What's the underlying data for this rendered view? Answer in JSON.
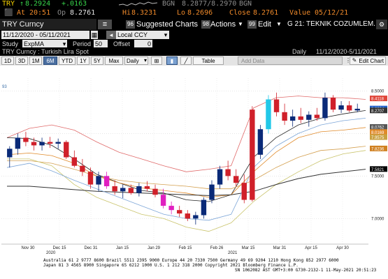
{
  "quote": {
    "ticker": "TRY",
    "last": "8.2924",
    "change": "+.0163",
    "source1": "BGN",
    "bid_ask": "8.2877/8.2970",
    "source2": "BGN",
    "at_label": "At",
    "time": "20:51",
    "op_label": "Op",
    "open": "8.2761",
    "hi_label": "Hi",
    "high": "8.3231",
    "lo_label": "Lo",
    "low": "8.2696",
    "close_label": "Close",
    "close": "8.2761",
    "value_label": "Value",
    "value_date": "05/12/21"
  },
  "toolbar": {
    "title": "TRY Curncy",
    "suggested_num": "96",
    "suggested_label": "Suggested Charts",
    "actions_num": "98",
    "actions_label": "Actions",
    "edit_num": "99",
    "edit_label": "Edit",
    "g_label": "G 21: TEKNIK COZUMLEM..."
  },
  "range": {
    "dates": "11/12/2020 - 05/11/2021",
    "currency": "Local CCY"
  },
  "study": {
    "study_label": "Study",
    "study_value": "ExpMA",
    "period_label": "Period",
    "period_value": "50",
    "offset_label": "Offset",
    "offset_value": "0"
  },
  "info": {
    "description": "TRY Curncy : Turkish Lira Spot",
    "frequency": "Daily",
    "span": "11/12/2020-5/11/2021"
  },
  "periods": [
    "1D",
    "3D",
    "1M",
    "6M",
    "YTD",
    "1Y",
    "5Y",
    "Max"
  ],
  "selected_period": "6M",
  "freq_select": "Daily",
  "table_label": "Table",
  "add_data_label": "Add Data",
  "edit_chart_label": "Edit Chart",
  "chart_data": {
    "type": "line",
    "title": "",
    "x_labels": [
      "Nov 30",
      "Dec 15",
      "Dec 31",
      "Jan 15",
      "Jan 29",
      "Feb 15",
      "Feb 26",
      "Mar 15",
      "Mar 31",
      "Apr 15",
      "Apr 30"
    ],
    "year_labels": [
      "2020",
      "2021"
    ],
    "y_ticks": [
      "8.5000",
      "8.0000",
      "7.5000",
      "7.0000"
    ],
    "ylim": [
      6.7,
      8.65
    ],
    "top_fragment": "93",
    "price_tags": [
      {
        "value": "8.4118",
        "color": "#e0463a"
      },
      {
        "value": "8.2924",
        "color": "#1f5fc8"
      },
      {
        "value": "8.2707",
        "color": "#333333"
      },
      {
        "value": "8.0762",
        "color": "#555555"
      },
      {
        "value": "8.0169",
        "color": "#e08a2a"
      },
      {
        "value": "7.9575",
        "color": "#c9a040"
      },
      {
        "value": "7.8236",
        "color": "#d08020"
      },
      {
        "value": "7.5821",
        "color": "#000000"
      }
    ],
    "series": [
      {
        "name": "",
        "color": "#e06a6a",
        "values": [
          7.95,
          8.06,
          8.1,
          8.04,
          7.9,
          7.78,
          7.7,
          7.62,
          7.55,
          7.58,
          7.62,
          8.3,
          8.42,
          8.44,
          8.42,
          8.42,
          8.4
        ]
      },
      {
        "name": "",
        "color": "#222222",
        "values": [
          7.95,
          7.94,
          7.86,
          7.7,
          7.52,
          7.42,
          7.33,
          7.3,
          7.22,
          7.2,
          7.28,
          7.72,
          7.95,
          8.1,
          8.18,
          8.23,
          8.27
        ]
      },
      {
        "name": "",
        "color": "#e08a2a",
        "values": [
          7.75,
          7.77,
          7.74,
          7.65,
          7.5,
          7.42,
          7.36,
          7.33,
          7.3,
          7.25,
          7.28,
          7.55,
          7.78,
          7.95,
          8.02,
          8.04,
          8.07
        ]
      },
      {
        "name": "",
        "color": "#d4a050",
        "values": [
          7.68,
          7.68,
          7.65,
          7.58,
          7.5,
          7.45,
          7.42,
          7.4,
          7.38,
          7.35,
          7.35,
          7.45,
          7.6,
          7.72,
          7.8,
          7.82,
          7.85
        ]
      },
      {
        "name": "",
        "color": "#c9c36a",
        "values": [
          7.7,
          7.7,
          7.62,
          7.4,
          7.25,
          7.15,
          7.05,
          7.0,
          6.9,
          6.85,
          6.95,
          7.2,
          7.4,
          7.55,
          7.68,
          7.76,
          7.8
        ]
      },
      {
        "name": "",
        "color": "#333333",
        "values": [
          7.38,
          7.38,
          7.36,
          7.34,
          7.32,
          7.31,
          7.3,
          7.29,
          7.28,
          7.27,
          7.28,
          7.32,
          7.4,
          7.47,
          7.52,
          7.55,
          7.58
        ]
      },
      {
        "name": "",
        "color": "#7da6d8",
        "values": [
          7.6,
          7.65,
          7.56,
          7.45,
          7.35,
          7.25,
          7.15,
          7.05,
          7.0,
          6.98,
          7.05,
          7.6,
          7.85,
          8.0,
          8.1,
          8.15,
          8.18
        ]
      }
    ],
    "candles": [
      {
        "o": 7.72,
        "h": 7.85,
        "l": 7.6,
        "c": 7.82,
        "col": "#0a2a78"
      },
      {
        "o": 7.82,
        "h": 8.0,
        "l": 7.75,
        "c": 7.95,
        "col": "#0a2a78"
      },
      {
        "o": 7.95,
        "h": 8.02,
        "l": 7.85,
        "c": 7.9,
        "col": "#d0202a"
      },
      {
        "o": 7.9,
        "h": 7.95,
        "l": 7.8,
        "c": 7.86,
        "col": "#d0202a"
      },
      {
        "o": 7.86,
        "h": 7.95,
        "l": 7.8,
        "c": 7.9,
        "col": "#0a2a78"
      },
      {
        "o": 7.9,
        "h": 7.96,
        "l": 7.83,
        "c": 7.88,
        "col": "#d0202a"
      },
      {
        "o": 7.88,
        "h": 7.94,
        "l": 7.82,
        "c": 7.9,
        "col": "#0a2a78"
      },
      {
        "o": 7.9,
        "h": 7.92,
        "l": 7.7,
        "c": 7.72,
        "col": "#d0202a"
      },
      {
        "o": 7.72,
        "h": 7.8,
        "l": 7.6,
        "c": 7.62,
        "col": "#d0202a"
      },
      {
        "o": 7.62,
        "h": 7.7,
        "l": 7.5,
        "c": 7.55,
        "col": "#d0202a"
      },
      {
        "o": 7.55,
        "h": 7.6,
        "l": 7.35,
        "c": 7.4,
        "col": "#d0202a"
      },
      {
        "o": 7.4,
        "h": 7.55,
        "l": 7.32,
        "c": 7.5,
        "col": "#0a2a78"
      },
      {
        "o": 7.5,
        "h": 7.55,
        "l": 7.35,
        "c": 7.38,
        "col": "#e020c0"
      },
      {
        "o": 7.38,
        "h": 7.45,
        "l": 7.28,
        "c": 7.32,
        "col": "#d0202a"
      },
      {
        "o": 7.32,
        "h": 7.4,
        "l": 7.24,
        "c": 7.36,
        "col": "#0a2a78"
      },
      {
        "o": 7.36,
        "h": 7.4,
        "l": 7.28,
        "c": 7.3,
        "col": "#d0202a"
      },
      {
        "o": 7.3,
        "h": 7.42,
        "l": 7.26,
        "c": 7.38,
        "col": "#0a2a78"
      },
      {
        "o": 7.38,
        "h": 7.44,
        "l": 7.32,
        "c": 7.35,
        "col": "#d0202a"
      },
      {
        "o": 7.35,
        "h": 7.4,
        "l": 7.25,
        "c": 7.28,
        "col": "#d0202a"
      },
      {
        "o": 7.28,
        "h": 7.35,
        "l": 7.12,
        "c": 7.15,
        "col": "#e020c0"
      },
      {
        "o": 7.15,
        "h": 7.2,
        "l": 7.05,
        "c": 7.1,
        "col": "#e020c0"
      },
      {
        "o": 7.1,
        "h": 7.15,
        "l": 7.02,
        "c": 7.06,
        "col": "#d0202a"
      },
      {
        "o": 7.06,
        "h": 7.1,
        "l": 6.97,
        "c": 7.0,
        "col": "#d0202a"
      },
      {
        "o": 7.0,
        "h": 7.08,
        "l": 6.93,
        "c": 7.04,
        "col": "#0a2a78"
      },
      {
        "o": 7.04,
        "h": 7.25,
        "l": 7.0,
        "c": 7.22,
        "col": "#0a2a78"
      },
      {
        "o": 7.22,
        "h": 7.45,
        "l": 7.18,
        "c": 7.4,
        "col": "#0a2a78"
      },
      {
        "o": 7.4,
        "h": 7.62,
        "l": 7.35,
        "c": 7.58,
        "col": "#0a2a78"
      },
      {
        "o": 7.58,
        "h": 7.68,
        "l": 7.45,
        "c": 7.5,
        "col": "#d0202a"
      },
      {
        "o": 7.5,
        "h": 7.58,
        "l": 7.38,
        "c": 7.42,
        "col": "#d0202a"
      },
      {
        "o": 7.42,
        "h": 7.52,
        "l": 7.18,
        "c": 7.22,
        "col": "#d0202a"
      },
      {
        "o": 7.22,
        "h": 8.32,
        "l": 7.2,
        "c": 8.28,
        "col": "#d0202a"
      },
      {
        "o": 7.75,
        "h": 8.1,
        "l": 7.7,
        "c": 8.05,
        "col": "#0a2a78"
      },
      {
        "o": 8.05,
        "h": 8.45,
        "l": 8.0,
        "c": 8.4,
        "col": "#22c8e8"
      },
      {
        "o": 8.4,
        "h": 8.48,
        "l": 8.2,
        "c": 8.25,
        "col": "#d0202a"
      },
      {
        "o": 8.25,
        "h": 8.35,
        "l": 8.1,
        "c": 8.15,
        "col": "#d0202a"
      },
      {
        "o": 8.15,
        "h": 8.28,
        "l": 8.08,
        "c": 8.2,
        "col": "#0a2a78"
      },
      {
        "o": 8.2,
        "h": 8.3,
        "l": 8.12,
        "c": 8.16,
        "col": "#d0202a"
      },
      {
        "o": 8.16,
        "h": 8.26,
        "l": 8.08,
        "c": 8.22,
        "col": "#0a2a78"
      },
      {
        "o": 8.22,
        "h": 8.3,
        "l": 8.15,
        "c": 8.18,
        "col": "#d0202a"
      },
      {
        "o": 8.18,
        "h": 8.48,
        "l": 8.15,
        "c": 8.42,
        "col": "#0a2a78"
      },
      {
        "o": 8.42,
        "h": 8.45,
        "l": 8.25,
        "c": 8.28,
        "col": "#d0202a"
      },
      {
        "o": 8.28,
        "h": 8.38,
        "l": 8.24,
        "c": 8.33,
        "col": "#0a2a78"
      },
      {
        "o": 8.33,
        "h": 8.38,
        "l": 8.25,
        "c": 8.27,
        "col": "#d0202a"
      },
      {
        "o": 8.27,
        "h": 8.35,
        "l": 8.25,
        "c": 8.29,
        "col": "#0a2a78"
      }
    ]
  },
  "footer": {
    "line1": "Australia 61 2 9777 8600 Brazil 5511 2395 9000 Europe 44 20 7330 7500 Germany 49 69 9204 1210 Hong Kong 852 2977 6000",
    "line2": "Japan 81 3 4565 8900        Singapore 65 6212 1000        U.S. 1 212 318 2000        Copyright 2021 Bloomberg Finance L.P.",
    "line3": "SN 1062082 AST  GMT+3:00 G730-2132-1 11-May-2021 20:51:23"
  }
}
